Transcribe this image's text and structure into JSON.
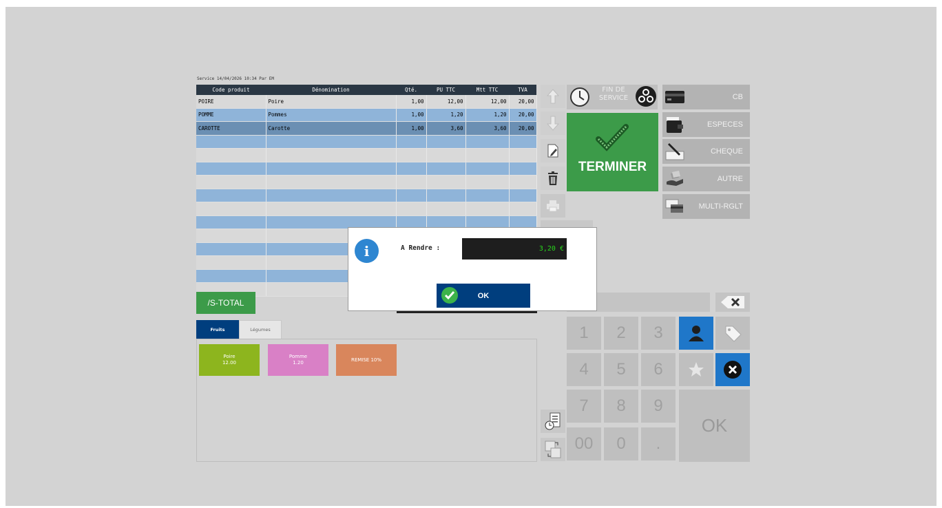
{
  "header": {
    "service_line": "Service 14/04/2026 10:34  Par EM"
  },
  "ticket": {
    "columns": [
      "Code produit",
      "Dénomination",
      "Qté.",
      "PU TTC",
      "Mtt TTC",
      "TVA"
    ],
    "rows": [
      {
        "code": "POIRE",
        "name": "Poire",
        "qty": "1,00",
        "pu": "12,00",
        "mtt": "12,00",
        "tva": "20,00",
        "state": "odd"
      },
      {
        "code": "POMME",
        "name": "Pommes",
        "qty": "1,00",
        "pu": "1,20",
        "mtt": "1,20",
        "tva": "20,00",
        "state": "even"
      },
      {
        "code": "CAROTTE",
        "name": "Carotte",
        "qty": "1,00",
        "pu": "3,60",
        "mtt": "3,60",
        "tva": "20,00",
        "state": "sel"
      }
    ]
  },
  "left": {
    "stotal_label": "/S-TOTAL",
    "tabs": [
      {
        "label": "Fruits",
        "active": true
      },
      {
        "label": "Légumes",
        "active": false
      }
    ],
    "products": [
      {
        "name": "Poire",
        "price": "12.00",
        "color": "#8db51e"
      },
      {
        "name": "Pomme",
        "price": "1.20",
        "color": "#d980c6"
      },
      {
        "name": "REMISE 10%",
        "price": "",
        "color": "#d9865c"
      }
    ]
  },
  "right": {
    "fin_service_label": "FIN DE SERVICE",
    "terminer_label": "TERMINER",
    "payments": [
      {
        "label": "CB",
        "icon": "card-icon"
      },
      {
        "label": "ESPECES",
        "icon": "wallet-icon"
      },
      {
        "label": "CHEQUE",
        "icon": "cheque-pen-icon"
      },
      {
        "label": "AUTRE",
        "icon": "hand-money-icon"
      },
      {
        "label": "MULTI-RGLT",
        "icon": "multi-payment-icon"
      }
    ],
    "keypad": {
      "keys": [
        "1",
        "2",
        "3",
        "4",
        "5",
        "6",
        "7",
        "8",
        "9",
        "00",
        "0",
        "."
      ],
      "ok_label": "OK"
    }
  },
  "dialog": {
    "label": "A Rendre :",
    "amount": "3,20 €",
    "ok_label": "OK"
  },
  "colors": {
    "green": "#3c9b49",
    "navy": "#003e7e",
    "blue": "#1f77c9",
    "amount_green": "#27d61b"
  }
}
